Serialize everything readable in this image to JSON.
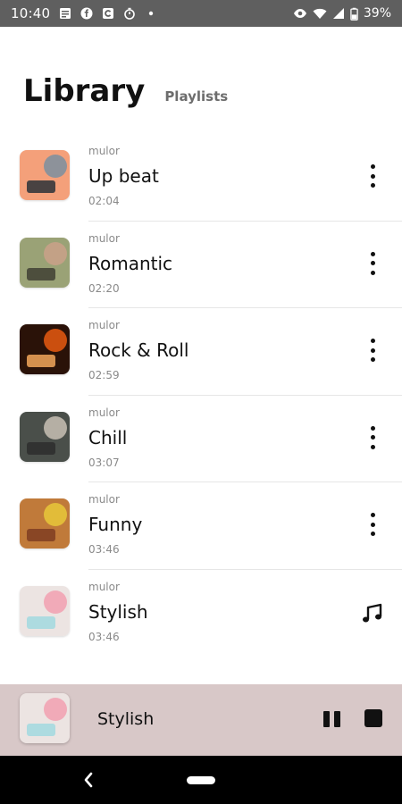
{
  "status_bar": {
    "time": "10:40",
    "battery_percent": "39%",
    "icons_left": [
      "news-icon",
      "f-app-icon",
      "c-app-icon",
      "timer-icon",
      "dot-icon"
    ],
    "icons_right": [
      "eye-icon",
      "wifi-icon",
      "signal-icon",
      "battery-icon"
    ]
  },
  "header": {
    "title": "Library",
    "tab_label": "Playlists"
  },
  "tracks": [
    {
      "artist": "mulor",
      "title": "Up beat",
      "duration": "02:04",
      "thumb_colors": [
        "#f4a07a",
        "#7a8fa0",
        "#1e2a35"
      ],
      "action_icon": "more-vert-icon"
    },
    {
      "artist": "mulor",
      "title": "Romantic",
      "duration": "02:20",
      "thumb_colors": [
        "#9aa276",
        "#caa18a",
        "#3a3a30"
      ],
      "action_icon": "more-vert-icon"
    },
    {
      "artist": "mulor",
      "title": "Rock & Roll",
      "duration": "02:59",
      "thumb_colors": [
        "#2a1208",
        "#e85a10",
        "#ffb060"
      ],
      "action_icon": "more-vert-icon"
    },
    {
      "artist": "mulor",
      "title": "Chill",
      "duration": "03:07",
      "thumb_colors": [
        "#4a4f4a",
        "#c8c0b4",
        "#2a2a2a"
      ],
      "action_icon": "more-vert-icon"
    },
    {
      "artist": "mulor",
      "title": "Funny",
      "duration": "03:46",
      "thumb_colors": [
        "#c07a3a",
        "#e8c83a",
        "#7a3a20"
      ],
      "action_icon": "more-vert-icon"
    },
    {
      "artist": "mulor",
      "title": "Stylish",
      "duration": "03:46",
      "thumb_colors": [
        "#ece4e2",
        "#f2a0b0",
        "#9ed8e0"
      ],
      "action_icon": "music-note-icon"
    }
  ],
  "player": {
    "title": "Stylish",
    "thumb_colors": [
      "#ece4e2",
      "#f2a0b0",
      "#9ed8e0"
    ],
    "background": "#d8c8c8"
  },
  "colors": {
    "status_bar": "#5f5f5f",
    "nav_bar": "#000000",
    "text_primary": "#111111",
    "text_secondary": "#8a8a8a"
  }
}
